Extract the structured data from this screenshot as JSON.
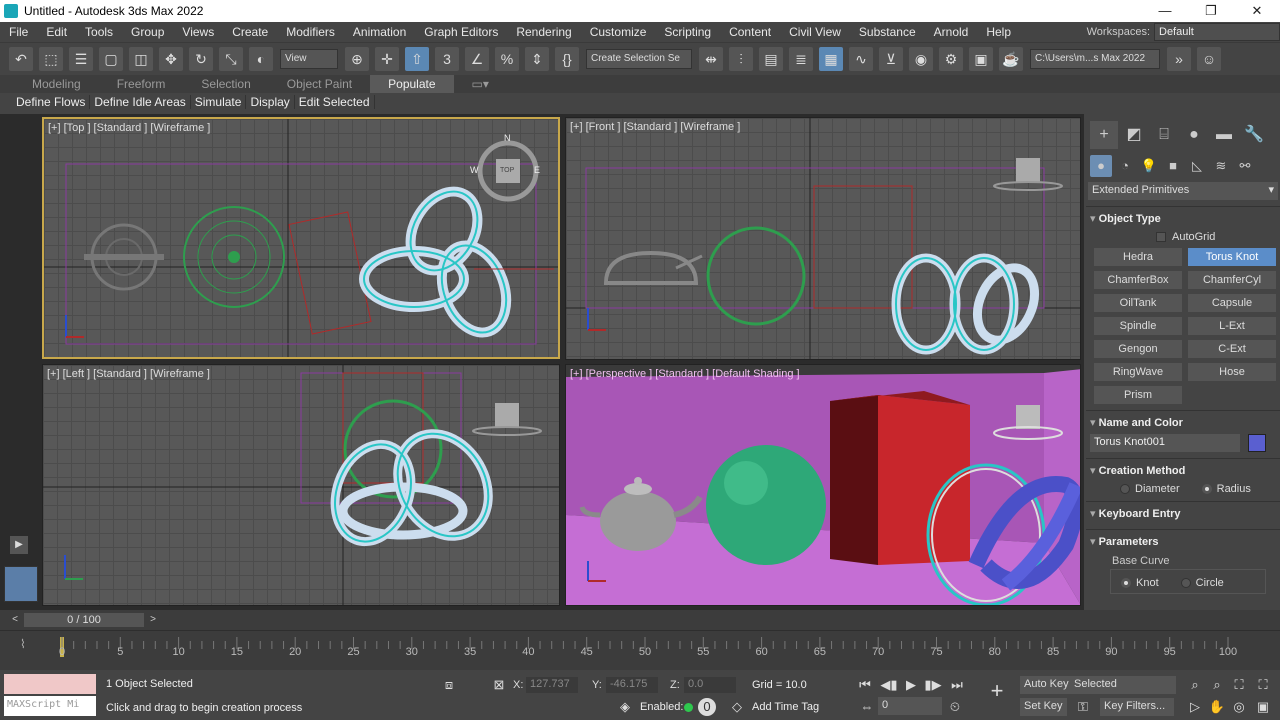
{
  "window": {
    "title": "Untitled - Autodesk 3ds Max 2022",
    "minimize": "—",
    "maximize": "❐",
    "close": "✕"
  },
  "menu": [
    "File",
    "Edit",
    "Tools",
    "Group",
    "Views",
    "Create",
    "Modifiers",
    "Animation",
    "Graph Editors",
    "Rendering",
    "Customize",
    "Scripting",
    "Content",
    "Civil View",
    "Substance",
    "Arnold",
    "Help"
  ],
  "workspace": {
    "label": "Workspaces:",
    "value": "Default"
  },
  "toolbar": {
    "view_dropdown": "View",
    "selection_set": "Create Selection Se",
    "project_path": "C:\\Users\\m...s Max 2022",
    "spinner_snap": "3",
    "percent_snap": "%"
  },
  "ribbon": {
    "tabs": [
      "Modeling",
      "Freeform",
      "Selection",
      "Object Paint",
      "Populate"
    ],
    "active_tab": "Populate",
    "sub_items": [
      "Define Flows",
      "Define Idle Areas",
      "Simulate",
      "Display",
      "Edit Selected"
    ]
  },
  "viewports": {
    "top": {
      "label": "[+] [Top ] [Standard ] [Wireframe ]"
    },
    "front": {
      "label": "[+] [Front ] [Standard ] [Wireframe ]"
    },
    "left": {
      "label": "[+] [Left ] [Standard ] [Wireframe ]"
    },
    "perspective": {
      "label": "[+] [Perspective ] [Standard ] [Default Shading ]"
    },
    "compass": {
      "n": "N",
      "w": "W",
      "e": "E",
      "cube": "TOP"
    }
  },
  "command_panel": {
    "category_dropdown": "Extended Primitives",
    "object_type": {
      "title": "Object Type",
      "autogrid": "AutoGrid",
      "buttons": [
        "Hedra",
        "Torus Knot",
        "ChamferBox",
        "ChamferCyl",
        "OilTank",
        "Capsule",
        "Spindle",
        "L-Ext",
        "Gengon",
        "C-Ext",
        "RingWave",
        "Hose",
        "Prism"
      ],
      "active": "Torus Knot"
    },
    "name_color": {
      "title": "Name and Color",
      "name": "Torus Knot001",
      "color": "#5a5fd0"
    },
    "creation_method": {
      "title": "Creation Method",
      "options": [
        "Diameter",
        "Radius"
      ],
      "selected": "Radius"
    },
    "keyboard_entry": {
      "title": "Keyboard Entry"
    },
    "parameters": {
      "title": "Parameters",
      "base_curve": "Base Curve",
      "options": [
        "Knot",
        "Circle"
      ],
      "selected": "Knot"
    }
  },
  "timeline": {
    "frame_display": "0 / 100",
    "ticks": [
      0,
      5,
      10,
      15,
      20,
      25,
      30,
      35,
      40,
      45,
      50,
      55,
      60,
      65,
      70,
      75,
      80,
      85,
      90,
      95,
      100
    ]
  },
  "status": {
    "maxscript": "MAXScript Mi",
    "selected": "1 Object Selected",
    "prompt": "Click and drag to begin creation process",
    "x_label": "X:",
    "x_value": "127.737",
    "y_label": "Y:",
    "y_value": "-46.175",
    "z_label": "Z:",
    "z_value": "0.0",
    "grid": "Grid = 10.0",
    "enabled": "Enabled:",
    "add_time_tag": "Add Time Tag",
    "auto_key": "Auto Key",
    "set_key": "Set Key",
    "selected_dd": "Selected",
    "key_filters": "Key Filters...",
    "frame_value": "0"
  },
  "colors": {
    "accent": "#5b8dc9",
    "active_vp_border": "#c8a84b",
    "persp_bg": "#b65ac6",
    "sphere": "#2ea878",
    "box": "#c8262c",
    "knot": "#4b50c8"
  }
}
